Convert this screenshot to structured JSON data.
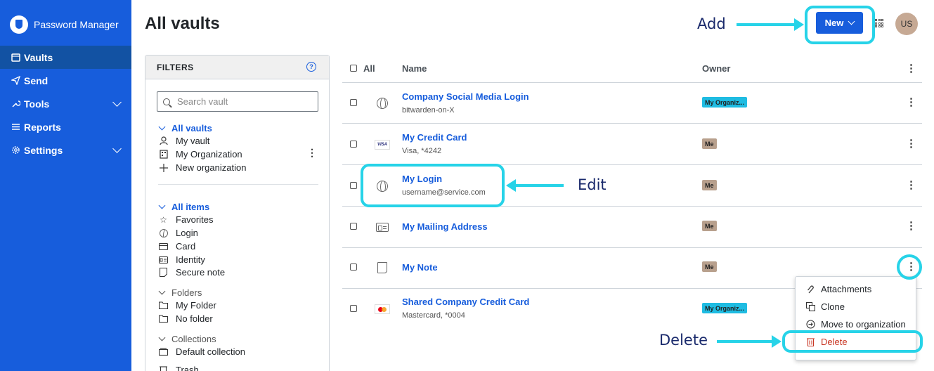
{
  "app": {
    "name": "Password Manager"
  },
  "nav": [
    {
      "label": "Vaults",
      "icon": "vault-icon"
    },
    {
      "label": "Send",
      "icon": "send-icon"
    },
    {
      "label": "Tools",
      "icon": "wrench-icon"
    },
    {
      "label": "Reports",
      "icon": "reports-icon"
    },
    {
      "label": "Settings",
      "icon": "gear-icon"
    }
  ],
  "header": {
    "title": "All vaults",
    "new_label": "New",
    "avatar_initials": "US"
  },
  "filters": {
    "title": "FILTERS",
    "search_placeholder": "Search vault",
    "all_vaults": "All vaults",
    "vaults": [
      "My vault",
      "My Organization",
      "New organization"
    ],
    "all_items": "All items",
    "types": [
      "Favorites",
      "Login",
      "Card",
      "Identity",
      "Secure note"
    ],
    "folders_label": "Folders",
    "folders": [
      "My Folder",
      "No folder"
    ],
    "collections_label": "Collections",
    "collections": [
      "Default collection"
    ],
    "trash": "Trash"
  },
  "table": {
    "headers": {
      "all": "All",
      "name": "Name",
      "owner": "Owner"
    },
    "rows": [
      {
        "name": "Company Social Media Login",
        "sub": "bitwarden-on-X",
        "owner": "My Organiz...",
        "icon": "globe-icon"
      },
      {
        "name": "My Credit Card",
        "sub": "Visa, *4242",
        "owner": "Me",
        "icon": "visa-icon",
        "brand": "VISA"
      },
      {
        "name": "My Login",
        "sub": "username@service.com",
        "owner": "Me",
        "icon": "globe-icon"
      },
      {
        "name": "My Mailing Address",
        "sub": "",
        "owner": "Me",
        "icon": "id-card-icon"
      },
      {
        "name": "My Note",
        "sub": "",
        "owner": "Me",
        "icon": "note-icon"
      },
      {
        "name": "Shared Company Credit Card",
        "sub": "Mastercard, *0004",
        "owner": "My Organiz...",
        "icon": "mastercard-icon"
      }
    ]
  },
  "menu": {
    "items": [
      {
        "label": "Attachments",
        "icon": "paperclip-icon"
      },
      {
        "label": "Clone",
        "icon": "clone-icon"
      },
      {
        "label": "Move to organization",
        "icon": "move-icon"
      },
      {
        "label": "Delete",
        "icon": "trash-icon"
      }
    ]
  },
  "annotations": {
    "add": "Add",
    "edit": "Edit",
    "delete": "Delete"
  },
  "colors": {
    "brand": "#175ddc",
    "sidebar_active": "#1252a3",
    "org_badge": "#1fbce2",
    "me_badge": "#b8a08d",
    "annotation": "#27d3e8",
    "danger": "#c83522"
  }
}
